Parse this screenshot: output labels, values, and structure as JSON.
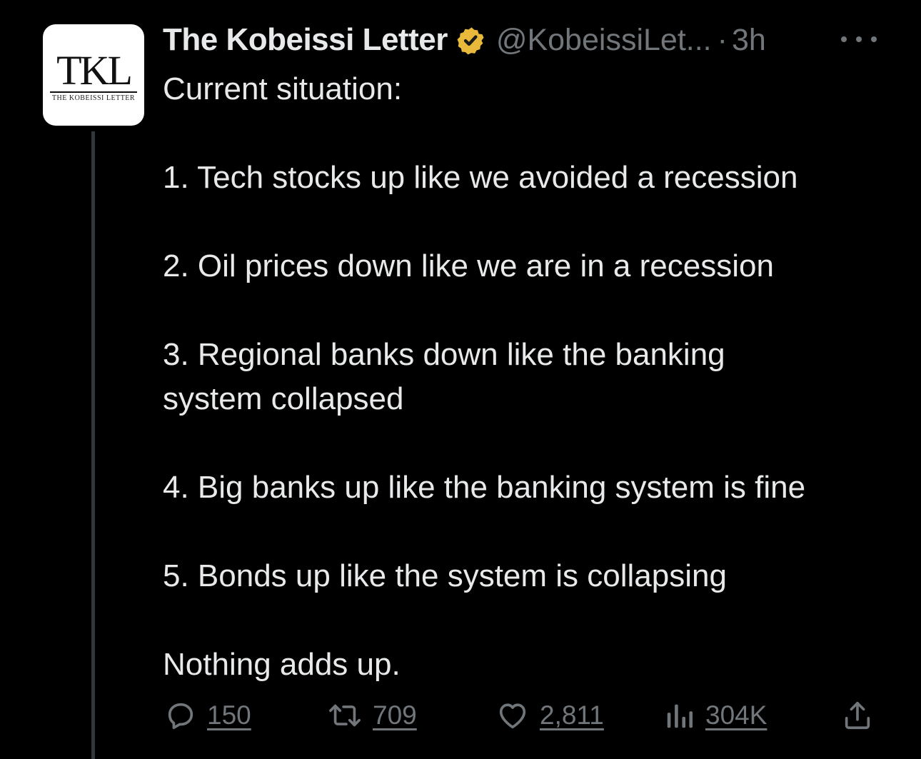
{
  "tweet": {
    "author": {
      "display_name": "The Kobeissi Letter",
      "handle": "@KobeissiLet...",
      "separator": "·",
      "time": "3h",
      "verified_color": "#e8b93a",
      "avatar": {
        "monogram": "TKL",
        "subtitle": "THE KOBEISSI LETTER"
      }
    },
    "more_icon": "more-horizontal-icon",
    "text": {
      "intro": "Current situation:",
      "items": [
        "1. Tech stocks up like we avoided a recession",
        "2. Oil prices down like we are in a recession",
        "3. Regional banks down like the banking system collapsed",
        "4. Big banks up like the banking system is fine",
        "5. Bonds up like the system is collapsing"
      ],
      "closing": "Nothing adds up."
    },
    "actions": {
      "replies": {
        "icon": "reply-icon",
        "count": "150"
      },
      "reposts": {
        "icon": "repost-icon",
        "count": "709"
      },
      "likes": {
        "icon": "heart-icon",
        "count": "2,811"
      },
      "views": {
        "icon": "views-icon",
        "count": "304K"
      },
      "share": {
        "icon": "share-icon"
      }
    }
  }
}
